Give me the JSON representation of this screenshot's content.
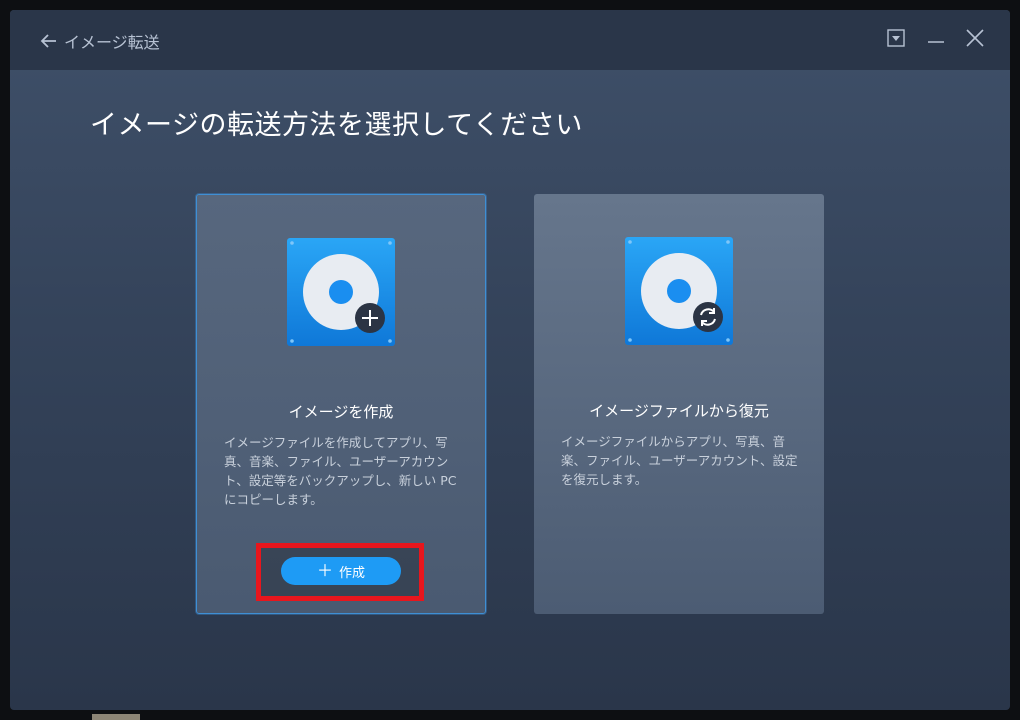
{
  "window": {
    "title": "イメージ転送",
    "controls": [
      "dropdown-icon",
      "minimize-icon",
      "close-icon"
    ]
  },
  "page": {
    "heading": "イメージの転送方法を選択してください"
  },
  "cards": {
    "create": {
      "title": "イメージを作成",
      "description": "イメージファイルを作成してアプリ、写真、音楽、ファイル、ユーザーアカウント、設定等をバックアップし、新しい PC にコピーします。",
      "button_label": "作成",
      "icon": "disk-plus-icon"
    },
    "restore": {
      "title": "イメージファイルから復元",
      "description": "イメージファイルからアプリ、写真、音楽、ファイル、ユーザーアカウント、設定を復元します。",
      "icon": "disk-sync-icon"
    }
  },
  "colors": {
    "accent": "#1e9bf5",
    "highlight": "#e8161d",
    "titlebar": "#2a3649"
  }
}
